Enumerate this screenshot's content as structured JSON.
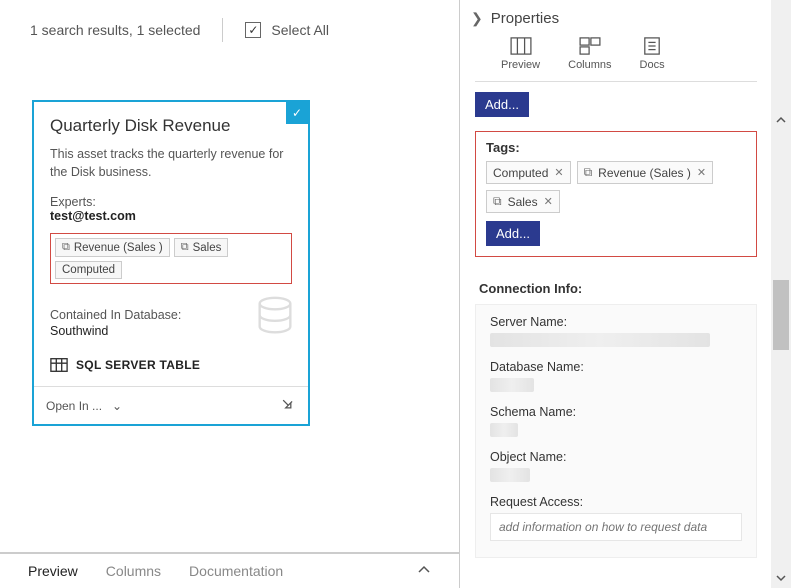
{
  "results": {
    "summary": "1 search results, 1 selected",
    "select_all": "Select All"
  },
  "card": {
    "title": "Quarterly Disk Revenue",
    "description": "This asset tracks the quarterly revenue for the Disk business.",
    "experts_label": "Experts:",
    "experts_value": "test@test.com",
    "tags": [
      "Revenue (Sales )",
      "Sales",
      "Computed"
    ],
    "contained_label": "Contained In Database:",
    "contained_value": "Southwind",
    "asset_type": "SQL SERVER TABLE",
    "open_in": "Open In ..."
  },
  "bottom_tabs": {
    "preview": "Preview",
    "columns": "Columns",
    "documentation": "Documentation"
  },
  "props": {
    "header": "Properties",
    "views": {
      "preview": "Preview",
      "columns": "Columns",
      "docs": "Docs"
    },
    "add": "Add...",
    "tags_label": "Tags:",
    "tags": [
      "Computed",
      "Revenue (Sales )",
      "Sales"
    ],
    "conn_label": "Connection Info:",
    "server_name_k": "Server Name:",
    "database_name_k": "Database Name:",
    "schema_name_k": "Schema Name:",
    "object_name_k": "Object Name:",
    "request_access_k": "Request Access:",
    "request_access_placeholder": "add information on how to request data"
  }
}
